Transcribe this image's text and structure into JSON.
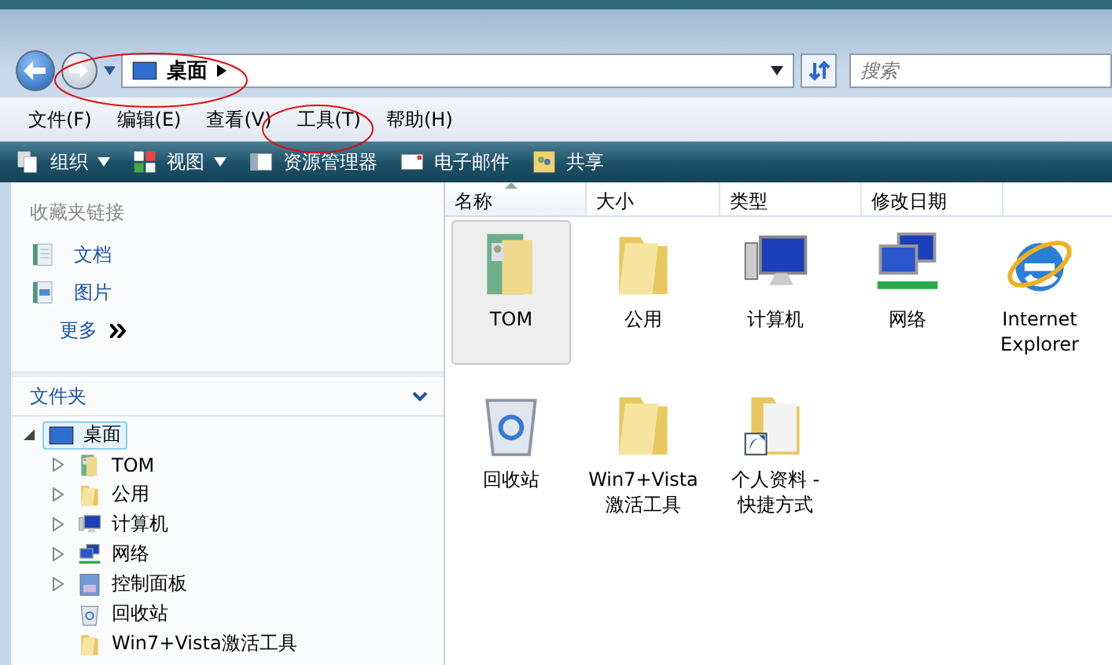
{
  "address_bar": {
    "location": "桌面",
    "search": {
      "placeholder": "搜索"
    }
  },
  "menu_bar": [
    "文件(F)",
    "编辑(E)",
    "查看(V)",
    "工具(T)",
    "帮助(H)"
  ],
  "toolbar": [
    {
      "label": "组织",
      "kind": "organize",
      "dropdown": true
    },
    {
      "label": "视图",
      "kind": "views",
      "dropdown": true
    },
    {
      "label": "资源管理器",
      "kind": "explorer",
      "dropdown": false
    },
    {
      "label": "电子邮件",
      "kind": "email",
      "dropdown": false
    },
    {
      "label": "共享",
      "kind": "share",
      "dropdown": false
    }
  ],
  "favorite_links": {
    "title": "收藏夹链接",
    "items": [
      {
        "label": "文档",
        "kind": "documents"
      },
      {
        "label": "图片",
        "kind": "pictures"
      }
    ],
    "more": "更多"
  },
  "folders": {
    "title": "文件夹",
    "tree": [
      {
        "label": "桌面",
        "kind": "desktop",
        "selected": true,
        "expanded": true,
        "children": [
          {
            "label": "TOM",
            "kind": "user",
            "selected": false,
            "expanded": false
          },
          {
            "label": "公用",
            "kind": "folder",
            "selected": false,
            "expanded": false
          },
          {
            "label": "计算机",
            "kind": "computer",
            "selected": false,
            "expanded": false
          },
          {
            "label": "网络",
            "kind": "network",
            "selected": false,
            "expanded": false
          },
          {
            "label": "控制面板",
            "kind": "control",
            "selected": false,
            "expanded": false
          },
          {
            "label": "回收站",
            "kind": "recycle",
            "selected": false
          },
          {
            "label": "Win7+Vista激活工具",
            "kind": "folder",
            "selected": false
          }
        ]
      }
    ]
  },
  "columns": [
    {
      "label": "名称",
      "sorted": true
    },
    {
      "label": "大小",
      "sorted": false
    },
    {
      "label": "类型",
      "sorted": false
    },
    {
      "label": "修改日期",
      "sorted": false
    }
  ],
  "files": [
    {
      "label": "TOM",
      "kind": "user",
      "selected": true
    },
    {
      "label": "公用",
      "kind": "folder",
      "selected": false
    },
    {
      "label": "计算机",
      "kind": "computer",
      "selected": false
    },
    {
      "label": "网络",
      "kind": "network",
      "selected": false
    },
    {
      "label": "Internet Explorer",
      "kind": "ie",
      "selected": false
    },
    {
      "label": "回收站",
      "kind": "recycle",
      "selected": false
    },
    {
      "label": "Win7+Vista 激活工具",
      "kind": "folder",
      "selected": false
    },
    {
      "label": "个人资料 - 快捷方式",
      "kind": "shortcut",
      "selected": false
    }
  ]
}
